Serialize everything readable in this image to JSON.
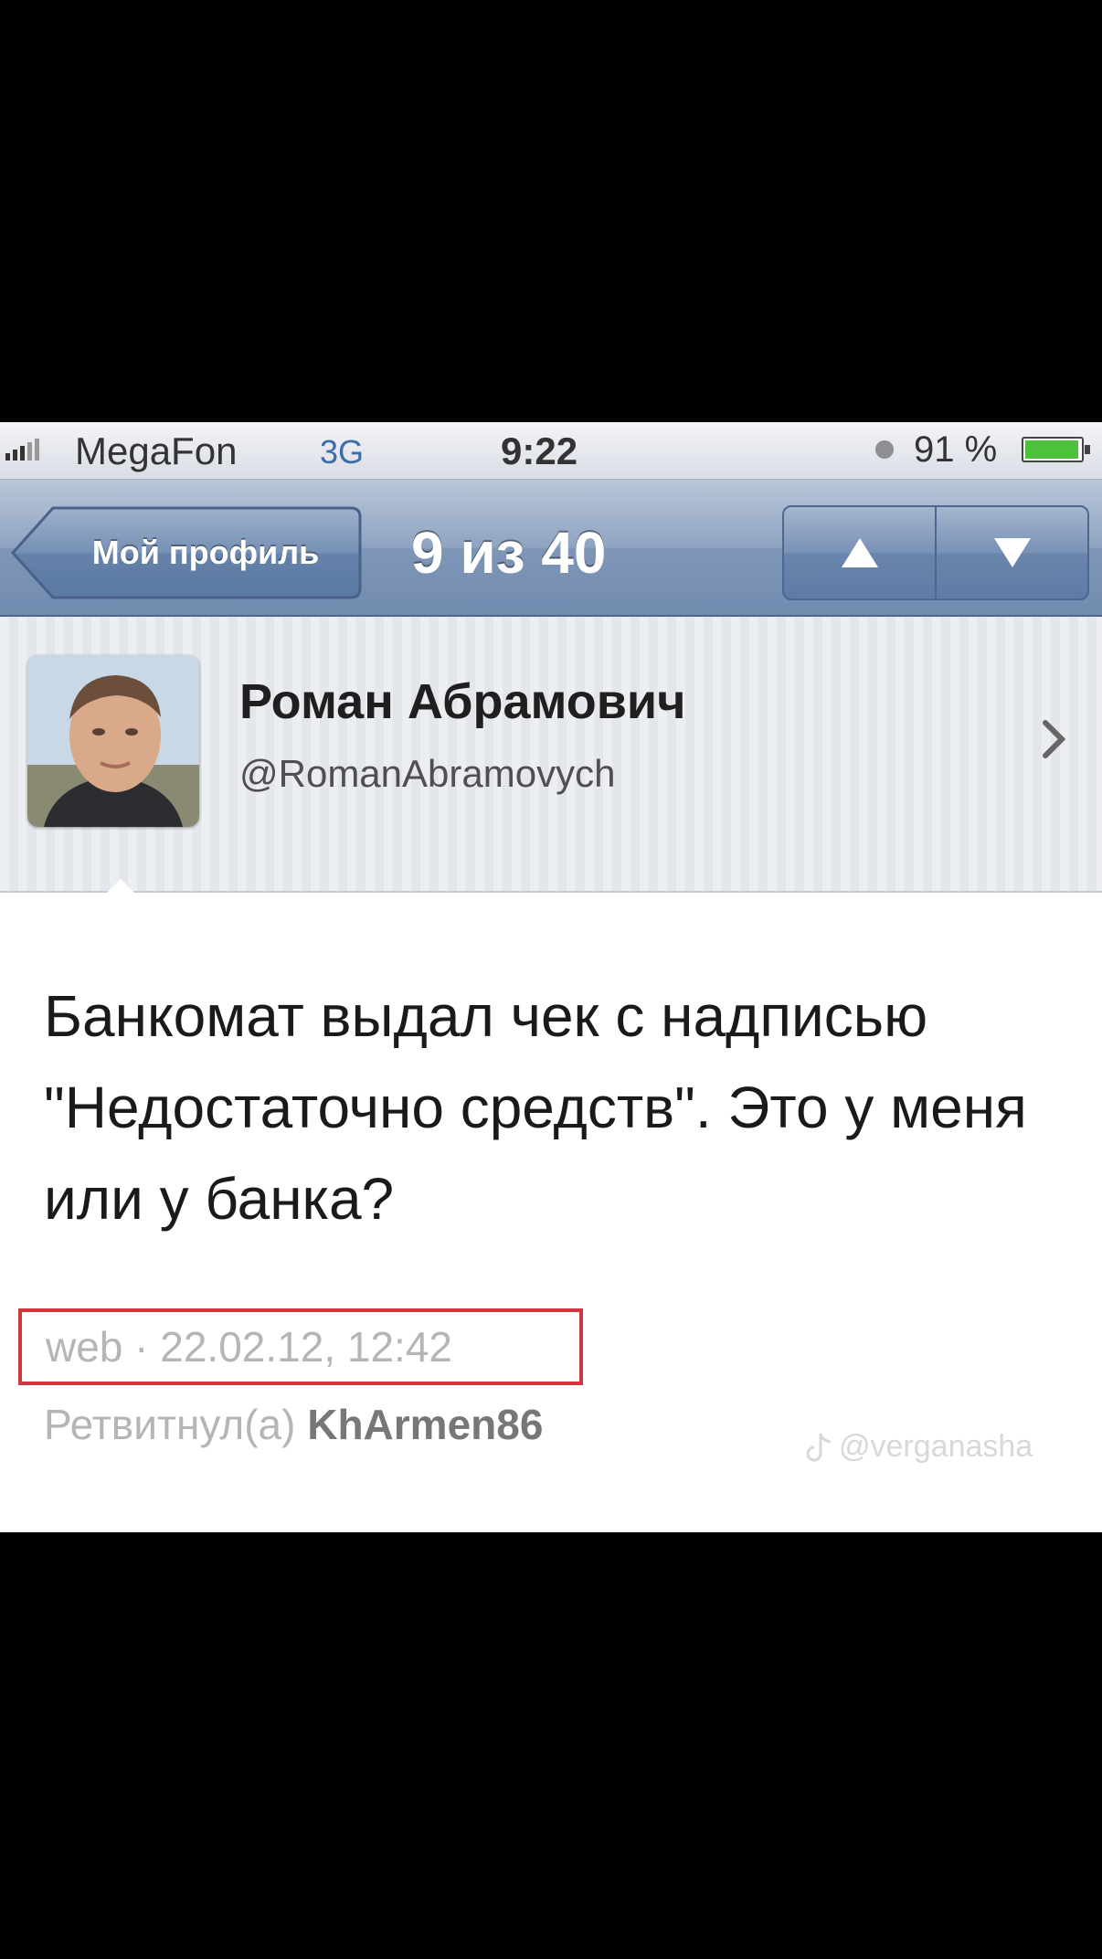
{
  "status_bar": {
    "carrier": "MegaFon",
    "network": "3G",
    "time": "9:22",
    "battery": "91 %"
  },
  "nav": {
    "back_label": "Мой профиль",
    "title": "9 из 40",
    "up_icon": "triangle-up-icon",
    "down_icon": "triangle-down-icon"
  },
  "profile": {
    "display_name": "Роман Абрамович",
    "handle": "@RomanAbramovych",
    "disclosure_icon": "chevron-right-icon"
  },
  "tweet": {
    "text": "Банкомат выдал чек с надписью \"Недостаточно средств\". Это у меня или у банка?",
    "source": "web · 22.02.12, 12:42",
    "retweet_prefix": "Ретвитнул(а)",
    "retweet_user": "KhArmen86"
  },
  "watermark": "@verganasha",
  "colors": {
    "nav_bar": "#7f96b7",
    "highlight_border": "#d0373f",
    "battery_fill": "#4cc23a"
  }
}
